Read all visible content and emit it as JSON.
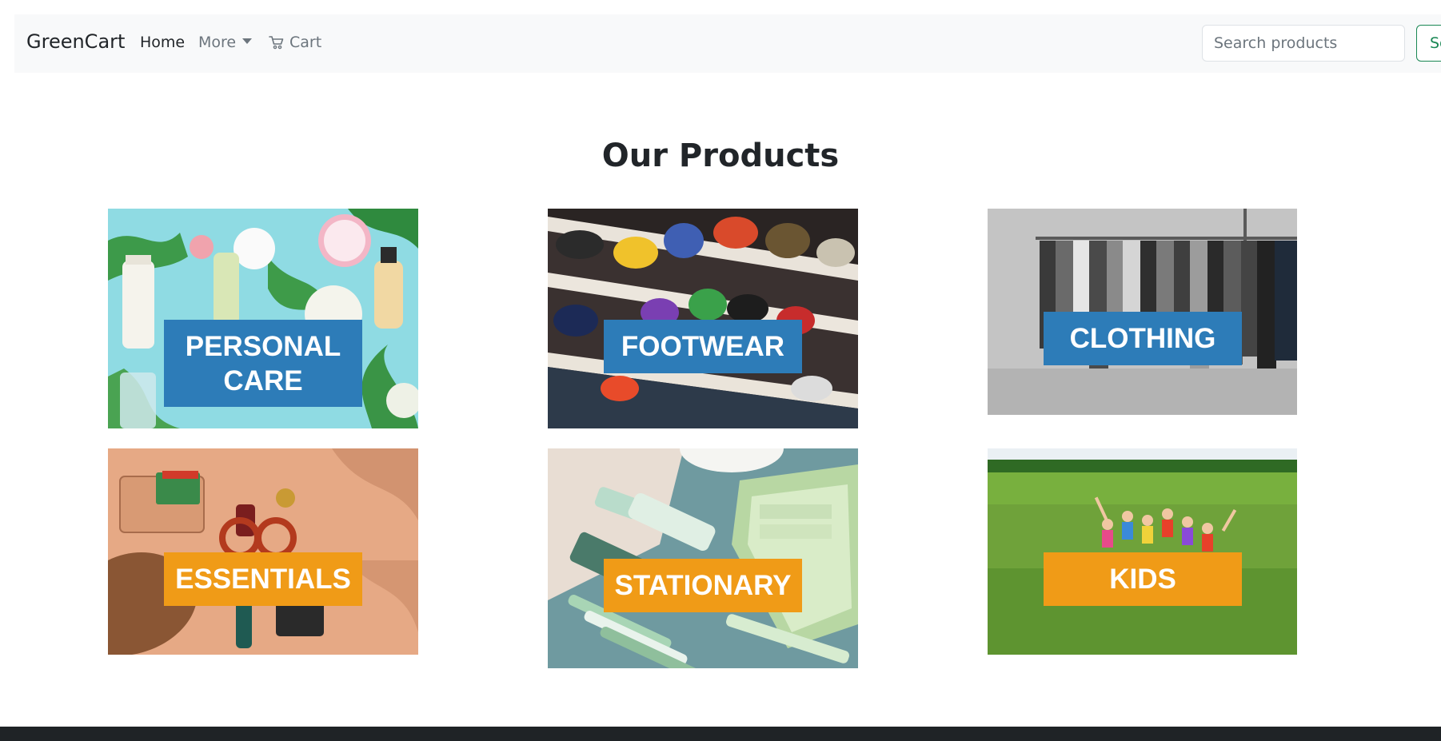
{
  "navbar": {
    "brand": "GreenCart",
    "links": {
      "home": "Home",
      "more": "More",
      "cart": "Cart"
    },
    "search": {
      "placeholder": "Search products",
      "button_label": "Se"
    }
  },
  "main": {
    "title": "Our Products",
    "categories": [
      {
        "label": "PERSONAL CARE",
        "tag_color": "#2d7cb8",
        "photo": "cosmetics-flatlay"
      },
      {
        "label": "FOOTWEAR",
        "tag_color": "#2d7cb8",
        "photo": "sneaker-shelves"
      },
      {
        "label": "CLOTHING",
        "tag_color": "#2d7cb8",
        "photo": "clothes-rack"
      },
      {
        "label": "ESSENTIALS",
        "tag_color": "#f09b17",
        "photo": "accessories-flatlay"
      },
      {
        "label": "STATIONARY",
        "tag_color": "#f09b17",
        "photo": "pastel-stationery"
      },
      {
        "label": "KIDS",
        "tag_color": "#f09b17",
        "photo": "kids-in-field"
      }
    ]
  },
  "colors": {
    "navbar_bg": "#f8f9fa",
    "search_button": "#198754",
    "taskbar": "#1f2326"
  }
}
